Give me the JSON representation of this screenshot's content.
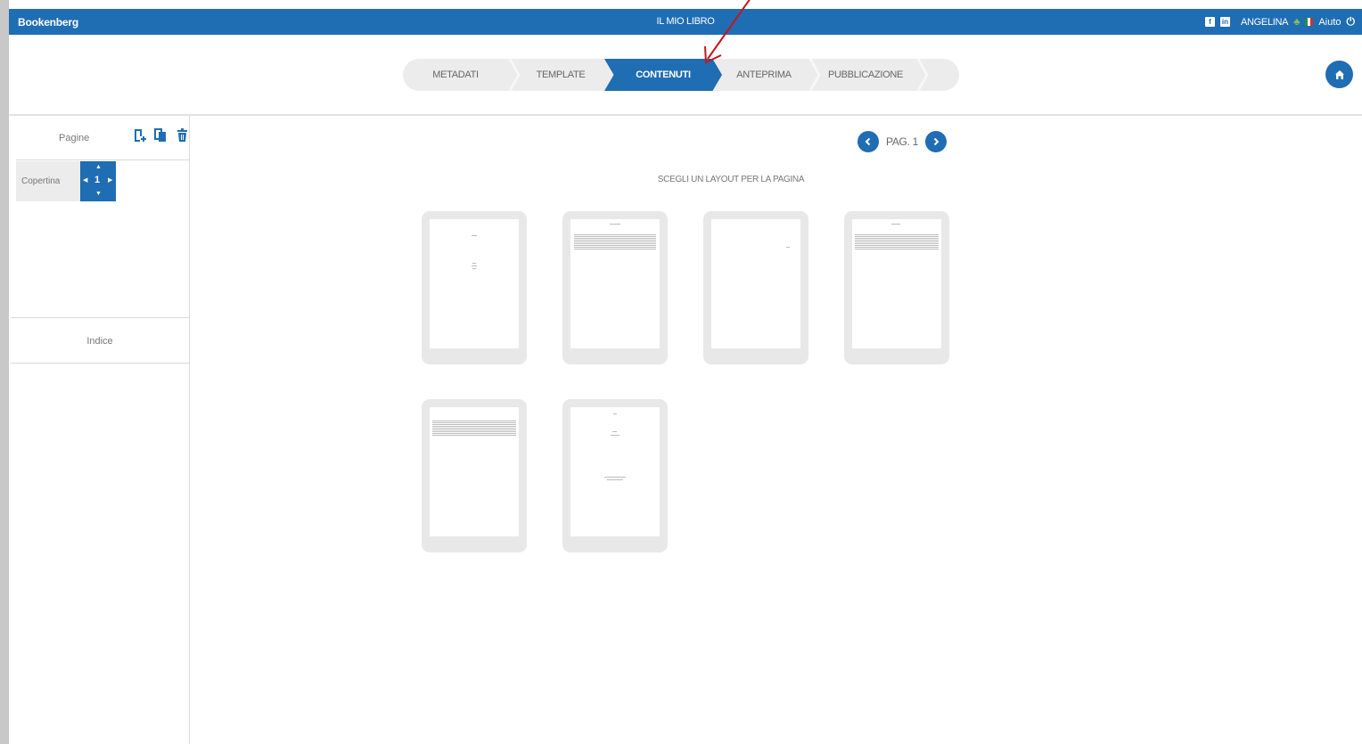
{
  "topbar": {
    "brand": "Bookenberg",
    "title": "IL MIO LIBRO",
    "facebook_icon": "f",
    "linkedin_icon": "in",
    "user": "ANGELINA",
    "help": "Aiuto",
    "accent_color": "#1f6db3"
  },
  "steps": [
    {
      "label": "METADATI",
      "active": false
    },
    {
      "label": "TEMPLATE",
      "active": false
    },
    {
      "label": "CONTENUTI",
      "active": true
    },
    {
      "label": "ANTEPRIMA",
      "active": false
    },
    {
      "label": "PUBBLICAZIONE",
      "active": false
    }
  ],
  "sidebar": {
    "pages_label": "Pagine",
    "cover_label": "Copertina",
    "cover_page_number": "1",
    "index_label": "Indice"
  },
  "pager": {
    "label": "PAG. 1"
  },
  "main": {
    "instruction": "SCEGLI UN LAYOUT PER LA PAGINA"
  },
  "icons": [
    "add-page-icon",
    "copy-page-icon",
    "delete-page-icon",
    "home-icon",
    "chevron-left-icon",
    "chevron-right-icon",
    "power-icon",
    "leaf-icon",
    "flag-icon"
  ]
}
